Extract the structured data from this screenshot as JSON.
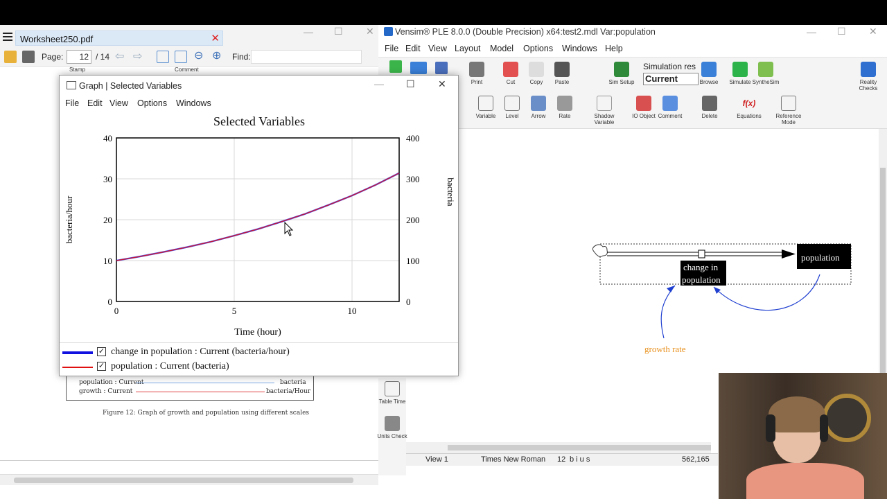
{
  "pdf": {
    "tab_title": "Worksheet250.pdf",
    "page_label": "Page:",
    "page_current": "12",
    "page_total": "/ 14",
    "find_label": "Find:",
    "stamp_label": "Stamp",
    "comment_label": "Comment",
    "legend": [
      {
        "name": "population : Current",
        "unit": "bacteria"
      },
      {
        "name": "growth : Current",
        "unit": "bacteria/Hour"
      }
    ],
    "caption": "Figure 12: Graph of growth and population using different scales"
  },
  "vensim": {
    "title": "Vensim® PLE 8.0.0 (Double Precision) x64:test2.mdl Var:population",
    "menu": [
      "File",
      "Edit",
      "View",
      "Layout",
      "Model",
      "Options",
      "Windows",
      "Help"
    ],
    "toolbar1": [
      "Print",
      "Cut",
      "Copy",
      "Paste",
      "Sim Setup",
      "Browse",
      "Simulate",
      "SyntheSim",
      "Reality Checks"
    ],
    "sim_label": "Simulation res",
    "sim_value": "Current",
    "toolbar2": [
      "Variable",
      "Level",
      "Arrow",
      "Rate",
      "Shadow Variable",
      "IO Object",
      "Comment",
      "Delete",
      "Equations",
      "Reference Mode"
    ],
    "side_tools": [
      "Table Time",
      "Units Check"
    ],
    "diagram": {
      "stock": "population",
      "rate_line1": "change in",
      "rate_line2": "population",
      "aux": "growth rate"
    },
    "status": {
      "view": "View 1",
      "font": "Times New Roman",
      "size": "12",
      "styles": "b i u s",
      "coords": "562,165"
    },
    "colors": {
      "aux_text": "#e8901c",
      "arrow": "#1f3fd0",
      "stock_bg": "#000000"
    }
  },
  "graph": {
    "window_title": "Graph | Selected Variables",
    "menu": [
      "File",
      "Edit",
      "View",
      "Options",
      "Windows"
    ],
    "legend": [
      {
        "label": "change in population : Current (bacteria/hour)",
        "color": "#1010e0",
        "checked": "✓"
      },
      {
        "label": "population : Current (bacteria)",
        "color": "#e01010",
        "checked": "✓"
      }
    ]
  },
  "chart_data": {
    "type": "line",
    "title": "Selected Variables",
    "xlabel": "Time (hour)",
    "ylabel_left": "bacteria/hour",
    "ylabel_right": "bacteria",
    "xlim": [
      0,
      12
    ],
    "ylim_left": [
      0,
      40
    ],
    "ylim_right": [
      0,
      400
    ],
    "x_ticks": [
      0,
      5,
      10
    ],
    "y_ticks_left": [
      0,
      10,
      20,
      30,
      40
    ],
    "y_ticks_right": [
      0,
      100,
      200,
      300,
      400
    ],
    "grid": true,
    "legend_position": "bottom",
    "series": [
      {
        "name": "change in population : Current",
        "axis": "left",
        "color": "#1010e0",
        "x": [
          0,
          1,
          2,
          3,
          4,
          5,
          6,
          7,
          8,
          9,
          10,
          11,
          12
        ],
        "values": [
          10,
          11.0,
          12.1,
          13.3,
          14.6,
          16.1,
          17.7,
          19.5,
          21.4,
          23.6,
          25.9,
          28.5,
          31.4
        ]
      },
      {
        "name": "population : Current",
        "axis": "right",
        "color": "#e01010",
        "x": [
          0,
          1,
          2,
          3,
          4,
          5,
          6,
          7,
          8,
          9,
          10,
          11,
          12
        ],
        "values": [
          100,
          110,
          121,
          133,
          146,
          161,
          177,
          195,
          214,
          236,
          259,
          285,
          314
        ]
      }
    ]
  }
}
